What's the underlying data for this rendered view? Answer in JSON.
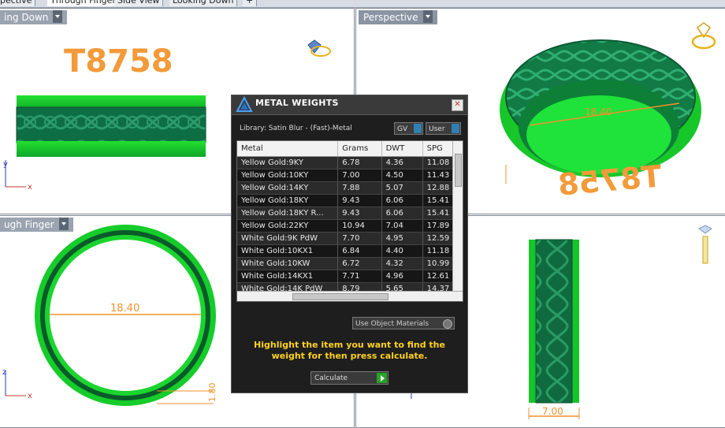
{
  "tabs": [
    {
      "label": "pective"
    },
    {
      "label": "Through Finger"
    },
    {
      "label": "Side View"
    },
    {
      "label": "Looking Down"
    },
    {
      "label": "+"
    }
  ],
  "viewports": {
    "top_left": {
      "label": "ing Down"
    },
    "top_right": {
      "label": "Perspective"
    },
    "bottom_left": {
      "label": "ugh Finger"
    }
  },
  "annotations": {
    "model_code": "T8758",
    "dim_diameter_top": "18.40",
    "dim_diameter_left": "18.40",
    "dim_thickness": "1.80",
    "dim_width": "7.00",
    "axis_y": "y",
    "axis_x": "x",
    "axis_z": "z"
  },
  "dialog": {
    "title": "METAL WEIGHTS",
    "library": "Library: Satin Blur - (Fast)-Metal",
    "gv_label": "GV",
    "user_label": "User",
    "columns": [
      "Metal",
      "Grams",
      "DWT",
      "SPG"
    ],
    "rows": [
      [
        "Yellow Gold:9KY",
        "6.78",
        "4.36",
        "11.08"
      ],
      [
        "Yellow Gold:10KY",
        "7.00",
        "4.50",
        "11.43"
      ],
      [
        "Yellow Gold:14KY",
        "7.88",
        "5.07",
        "12.88"
      ],
      [
        "Yellow Gold:18KY",
        "9.43",
        "6.06",
        "15.41"
      ],
      [
        "Yellow Gold:18KY R...",
        "9.43",
        "6.06",
        "15.41"
      ],
      [
        "Yellow Gold:22KY",
        "10.94",
        "7.04",
        "17.89"
      ],
      [
        "White Gold:9K PdW",
        "7.70",
        "4.95",
        "12.59"
      ],
      [
        "White Gold:10KX1",
        "6.84",
        "4.40",
        "11.18"
      ],
      [
        "White Gold:10KW",
        "6.72",
        "4.32",
        "10.99"
      ],
      [
        "White Gold:14KX1",
        "7.71",
        "4.96",
        "12.61"
      ],
      [
        "White Gold:14K PdW",
        "8.79",
        "5.65",
        "14.37"
      ]
    ],
    "use_object_materials": "Use Object Materials",
    "hint": "Highlight the item you want to find the weight for then press calculate.",
    "calculate_label": "Calculate"
  },
  "colors": {
    "ring_green": "#1fd42a",
    "ring_dark": "#0f6b3a",
    "dimension_orange": "#f0922b",
    "hint_yellow": "#ffd21e"
  }
}
